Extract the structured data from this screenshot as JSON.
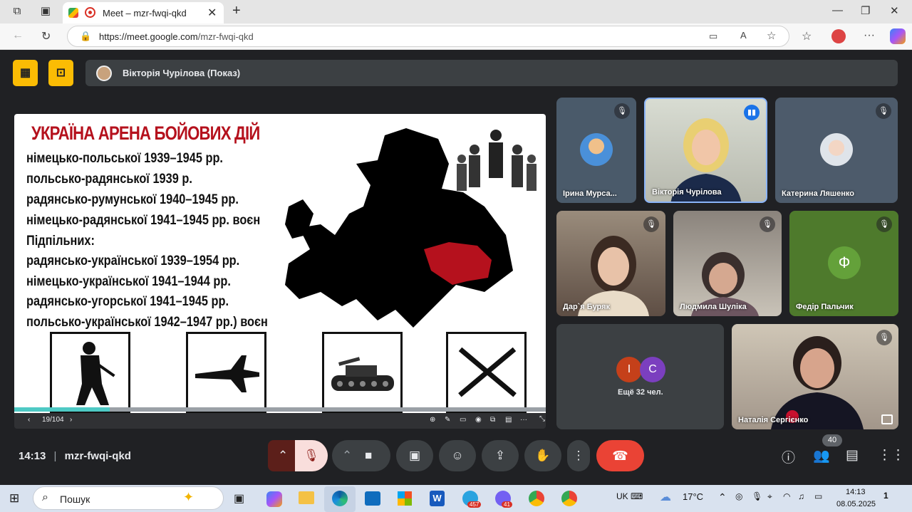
{
  "browser": {
    "tab_title": "Meet – mzr-fwqi-qkd",
    "url_host": "https://meet.google.com",
    "url_path": "/mzr-fwqi-qkd",
    "icons": [
      "tabs-icon",
      "window-icon",
      "record-icon",
      "close-icon",
      "new-tab-icon",
      "back-icon",
      "reload-icon",
      "lock-icon",
      "video-icon",
      "read-aloud-icon",
      "favorite-icon",
      "favorites-icon",
      "profile-icon",
      "more-icon",
      "copilot-icon"
    ]
  },
  "presenter": {
    "name": "Вікторія Чурілова (Показ)"
  },
  "slide": {
    "title": "УКРАЇНА АРЕНА БОЙОВИХ ДІЙ",
    "lines": [
      "німецько-польської  1939–1945 рр.",
      "польсько-радянської 1939 р.",
      "радянсько-румунської 1940–1945 рр.",
      "німецько-радянської 1941–1945 рр. воєн",
      "Підпільних:",
      "радянсько-української 1939–1954 рр.",
      " німецько-української 1941–1944 рр.",
      "радянсько-угорської 1941–1945 рр.",
      "польсько-української 1942–1947 рр.) воєн"
    ],
    "page": "19/104",
    "progress_fraction": 0.18,
    "colors": {
      "title": "#b5111d",
      "highlight": "#b5111d",
      "map": "#000000"
    }
  },
  "participants": [
    {
      "name": "Ірина Мурса...",
      "muted": true
    },
    {
      "name": "Вікторія Чурілова",
      "muted": false,
      "speaking": true
    },
    {
      "name": "Катерина Ляшенко",
      "muted": true
    },
    {
      "name": "Дар`я Буряк",
      "muted": true
    },
    {
      "name": "Людмила Шуліка",
      "muted": true
    },
    {
      "name": "Федір Пальчик",
      "muted": true,
      "initial": "Ф"
    },
    {
      "name": "Наталія Сергієнко",
      "muted": true
    }
  ],
  "others": {
    "initials": [
      "І",
      "С"
    ],
    "text": "Ещё 32 чел."
  },
  "meeting": {
    "time": "14:13",
    "separator": "|",
    "code": "mzr-fwqi-qkd",
    "participant_count": "40"
  },
  "taskbar": {
    "search_text": "Пошук",
    "lang": "UK",
    "weather": "17°C",
    "time": "14:13",
    "date": "08.05.2025",
    "badge_telegram": "457",
    "badge_viber": "41",
    "notif": "1"
  }
}
